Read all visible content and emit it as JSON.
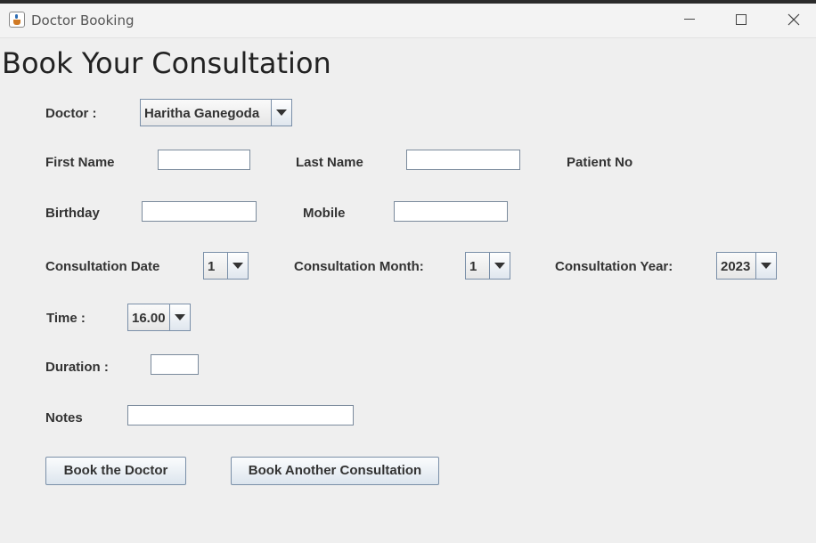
{
  "window": {
    "title": "Doctor Booking",
    "app_icon": "java-cup-icon",
    "controls": [
      "minimize-icon",
      "maximize-icon",
      "close-icon"
    ]
  },
  "heading": "Book Your Consultation",
  "form": {
    "doctor_label": "Doctor :",
    "doctor_selected": "Haritha Ganegoda",
    "first_name_label": "First Name",
    "first_name_value": "",
    "last_name_label": "Last Name",
    "last_name_value": "",
    "patient_no_label": "Patient No",
    "birthday_label": "Birthday",
    "birthday_value": "",
    "mobile_label": "Mobile",
    "mobile_value": "",
    "consultation_date_label": "Consultation Date",
    "consultation_date_selected": "1",
    "consultation_month_label": "Consultation Month:",
    "consultation_month_selected": "1",
    "consultation_year_label": "Consultation Year:",
    "consultation_year_selected": "2023",
    "time_label": "Time :",
    "time_selected": "16.00",
    "duration_label": "Duration :",
    "duration_value": "",
    "notes_label": "Notes",
    "notes_value": ""
  },
  "buttons": {
    "book_doctor": "Book the Doctor",
    "book_another": "Book Another Consultation"
  }
}
